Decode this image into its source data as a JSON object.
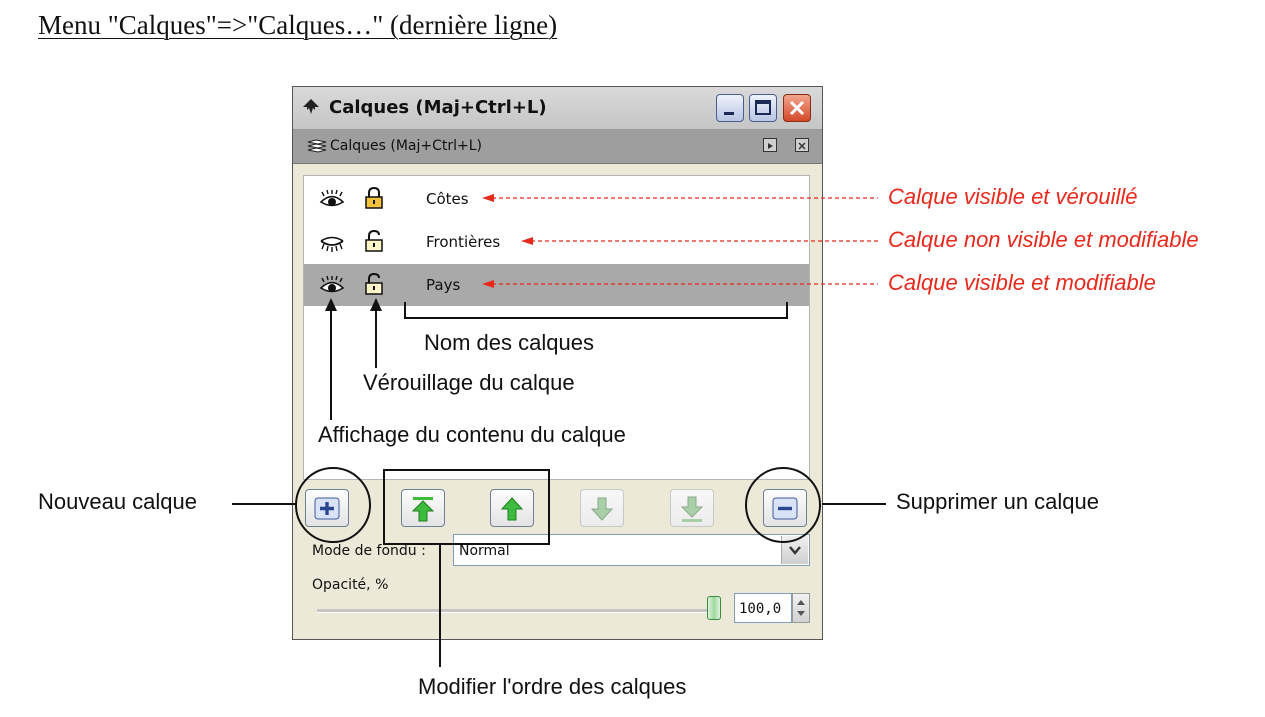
{
  "heading": "Menu \"Calques\"=>\"Calques…\" (dernière ligne)",
  "window": {
    "title": "Calques (Maj+Ctrl+L)",
    "title_icon": "inkscape-logo-icon",
    "controls": [
      "minimize-icon",
      "maximize-icon",
      "close-icon"
    ]
  },
  "dock": {
    "title": "Calques (Maj+Ctrl+L)",
    "icon": "layers-icon",
    "buttons": [
      "detach-icon",
      "close-icon"
    ]
  },
  "layers": [
    {
      "name": "Côtes",
      "visible": true,
      "locked": true,
      "selected": false
    },
    {
      "name": "Frontières",
      "visible": false,
      "locked": false,
      "selected": false
    },
    {
      "name": "Pays",
      "visible": true,
      "locked": false,
      "selected": true
    }
  ],
  "toolbar": {
    "buttons": [
      {
        "icon": "plus-icon",
        "enabled": true
      },
      {
        "icon": "raise-to-top-icon",
        "enabled": true
      },
      {
        "icon": "raise-icon",
        "enabled": true
      },
      {
        "icon": "lower-icon",
        "enabled": false
      },
      {
        "icon": "lower-to-bottom-icon",
        "enabled": false
      },
      {
        "icon": "minus-icon",
        "enabled": true
      }
    ]
  },
  "blend": {
    "label": "Mode de fondu :",
    "value": "Normal"
  },
  "opacity": {
    "label": "Opacité, %",
    "value": "100,0",
    "level": 1.0
  },
  "annotations": {
    "layer_states": [
      "Calque visible et vérouillé",
      "Calque non visible et modifiable",
      "Calque visible et modifiable"
    ],
    "names": "Nom des calques",
    "lock": "Vérouillage du calque",
    "visibility": "Affichage du contenu du calque",
    "new_layer": "Nouveau calque",
    "delete_layer": "Supprimer un calque",
    "reorder": "Modifier l'ordre des calques"
  },
  "colors": {
    "annotation_red": "#e8291c",
    "selected_row": "#a9a9a9",
    "arrow_green": "#3dbb3d"
  }
}
